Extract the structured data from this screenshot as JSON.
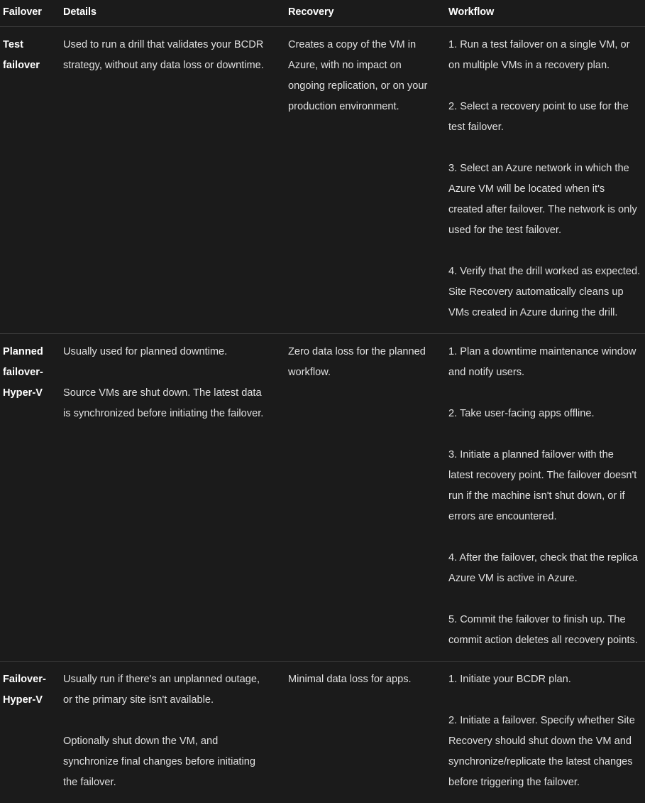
{
  "table": {
    "columns": [
      {
        "key": "failover",
        "label": "Failover"
      },
      {
        "key": "details",
        "label": "Details"
      },
      {
        "key": "recovery",
        "label": "Recovery"
      },
      {
        "key": "workflow",
        "label": "Workflow"
      }
    ],
    "rows": [
      {
        "failover": "Test failover",
        "details": [
          "Used to run a drill that validates your BCDR strategy, without any data loss or downtime."
        ],
        "recovery": [
          "Creates a copy of the VM in Azure, with no impact on ongoing replication, or on your production environment."
        ],
        "workflow": [
          "1. Run a test failover on a single VM, or on multiple VMs in a recovery plan.",
          "2. Select a recovery point to use for the test failover.",
          "3. Select an Azure network in which the Azure VM will be located when it's created after failover. The network is only used for the test failover.",
          "4. Verify that the drill worked as expected. Site Recovery automatically cleans up VMs created in Azure during the drill."
        ]
      },
      {
        "failover": "Planned failover-Hyper-V",
        "details": [
          "Usually used for planned downtime.",
          "Source VMs are shut down. The latest data is synchronized before initiating the failover."
        ],
        "recovery": [
          "Zero data loss for the planned workflow."
        ],
        "workflow": [
          "1. Plan a downtime maintenance window and notify users.",
          "2. Take user-facing apps offline.",
          "3. Initiate a planned failover with the latest recovery point. The failover doesn't run if the machine isn't shut down, or if errors are encountered.",
          "4. After the failover, check that the replica Azure VM is active in Azure.",
          "5. Commit the failover to finish up. The commit action deletes all recovery points."
        ]
      },
      {
        "failover": "Failover-Hyper-V",
        "details": [
          "Usually run if there's an unplanned outage, or the primary site isn't available.",
          "Optionally shut down the VM, and synchronize final changes before initiating the failover."
        ],
        "recovery": [
          "Minimal data loss for apps."
        ],
        "workflow": [
          "1. Initiate your BCDR plan.",
          "2. Initiate a failover. Specify whether Site Recovery should shut down the VM and synchronize/replicate the latest changes before triggering the failover."
        ]
      }
    ]
  },
  "theme": {
    "background": "#1b1b1b",
    "text": "#e0e0e0",
    "heading_text": "#ffffff",
    "divider": "#3b3b3b"
  }
}
